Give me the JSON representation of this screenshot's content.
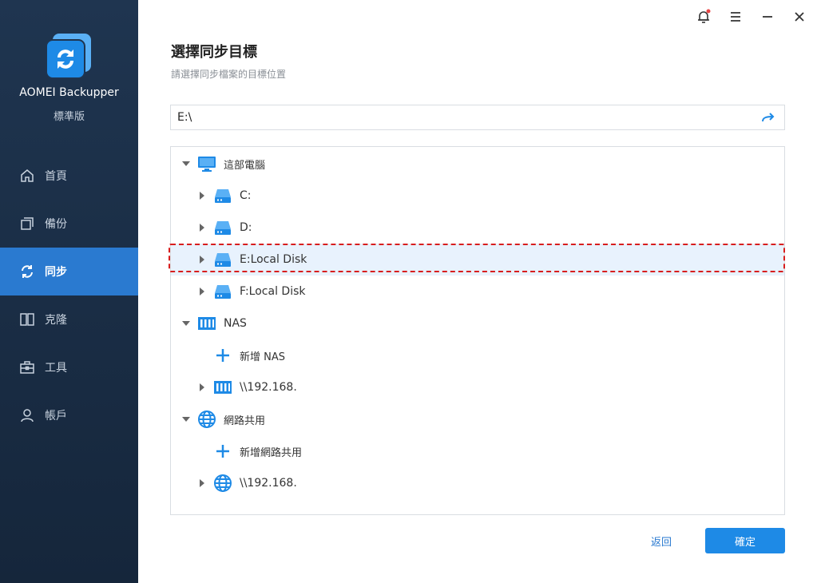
{
  "app": {
    "name": "AOMEI Backupper",
    "edition": "標準版"
  },
  "sidebar": {
    "items": [
      {
        "label": "首頁",
        "icon": "home-icon",
        "active": false
      },
      {
        "label": "備份",
        "icon": "backup-icon",
        "active": false
      },
      {
        "label": "同步",
        "icon": "sync-icon",
        "active": true
      },
      {
        "label": "克隆",
        "icon": "clone-icon",
        "active": false
      },
      {
        "label": "工具",
        "icon": "tools-icon",
        "active": false
      },
      {
        "label": "帳戶",
        "icon": "account-icon",
        "active": false
      }
    ]
  },
  "header": {
    "title": "選擇同步目標",
    "subtitle": "請選擇同步檔案的目標位置"
  },
  "path": {
    "value": "E:\\"
  },
  "tree": {
    "computer": {
      "label": "這部電腦"
    },
    "drives": [
      {
        "label": "C:"
      },
      {
        "label": "D:"
      },
      {
        "label": "E:Local Disk",
        "selected": true
      },
      {
        "label": "F:Local Disk"
      }
    ],
    "nas": {
      "label": "NAS",
      "add_label": "新增 NAS",
      "item_label": "\\\\192.168."
    },
    "network": {
      "label": "網路共用",
      "add_label": "新增網路共用",
      "item_label": "\\\\192.168."
    }
  },
  "footer": {
    "back_label": "返回",
    "ok_label": "確定"
  },
  "colors": {
    "accent": "#1e8ae6",
    "sidebar_bg": "#1f3550",
    "selection_outline": "#d81e1e",
    "notification_dot": "#e84545"
  }
}
